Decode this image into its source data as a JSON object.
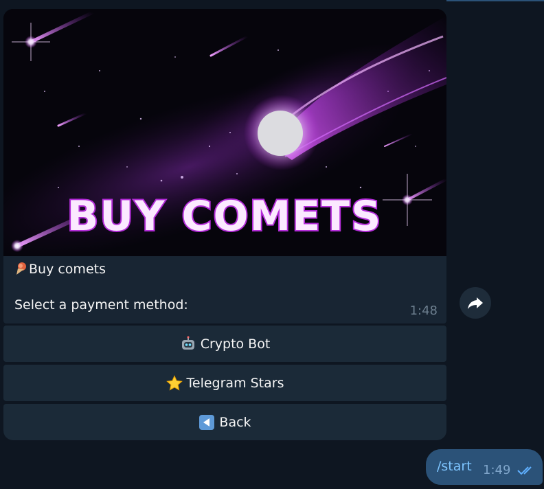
{
  "message": {
    "banner_text": "BUY COMETS",
    "title": "Buy comets",
    "body": "Select a payment method:",
    "time": "1:48"
  },
  "keyboard": {
    "buttons": [
      {
        "icon": "robot-icon",
        "label": "Crypto Bot"
      },
      {
        "icon": "star-icon",
        "label": "Telegram Stars"
      },
      {
        "icon": "back-arrow-icon",
        "label": "Back"
      }
    ]
  },
  "outgoing": {
    "text": "/start",
    "time": "1:49",
    "status": "read-double-check"
  },
  "colors": {
    "background": "#0e1621",
    "incoming_bubble": "#182533",
    "outgoing_bubble": "#2b5278",
    "accent": "#b32cd8"
  }
}
